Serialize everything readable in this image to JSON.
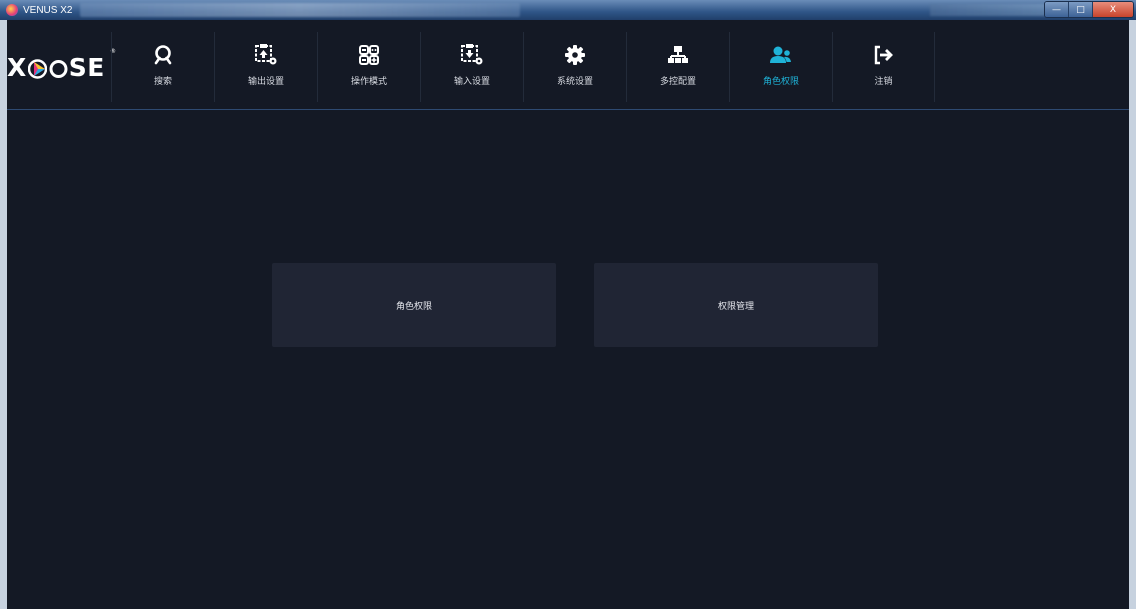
{
  "window": {
    "title": "VENUS X2",
    "controls": {
      "minimize": "—",
      "maximize": "□",
      "close": "X"
    }
  },
  "brand": {
    "logo_left": "X",
    "logo_right": "SE",
    "registered": "®",
    "colors": {
      "play_top": "#f5c32c",
      "play_mid": "#e2337d",
      "play_bottom": "#2aa9e0"
    }
  },
  "nav": {
    "items": [
      {
        "label": "搜索",
        "icon": "search-icon"
      },
      {
        "label": "输出设置",
        "icon": "output-settings-icon"
      },
      {
        "label": "操作模式",
        "icon": "operation-mode-icon"
      },
      {
        "label": "输入设置",
        "icon": "input-settings-icon"
      },
      {
        "label": "系统设置",
        "icon": "gear-icon"
      },
      {
        "label": "多控配置",
        "icon": "network-icon"
      },
      {
        "label": "角色权限",
        "icon": "users-icon",
        "active": true
      },
      {
        "label": "注销",
        "icon": "logout-icon"
      }
    ],
    "active_color": "#1fb3d8"
  },
  "main": {
    "cards": [
      {
        "label": "角色权限"
      },
      {
        "label": "权限管理"
      }
    ]
  }
}
